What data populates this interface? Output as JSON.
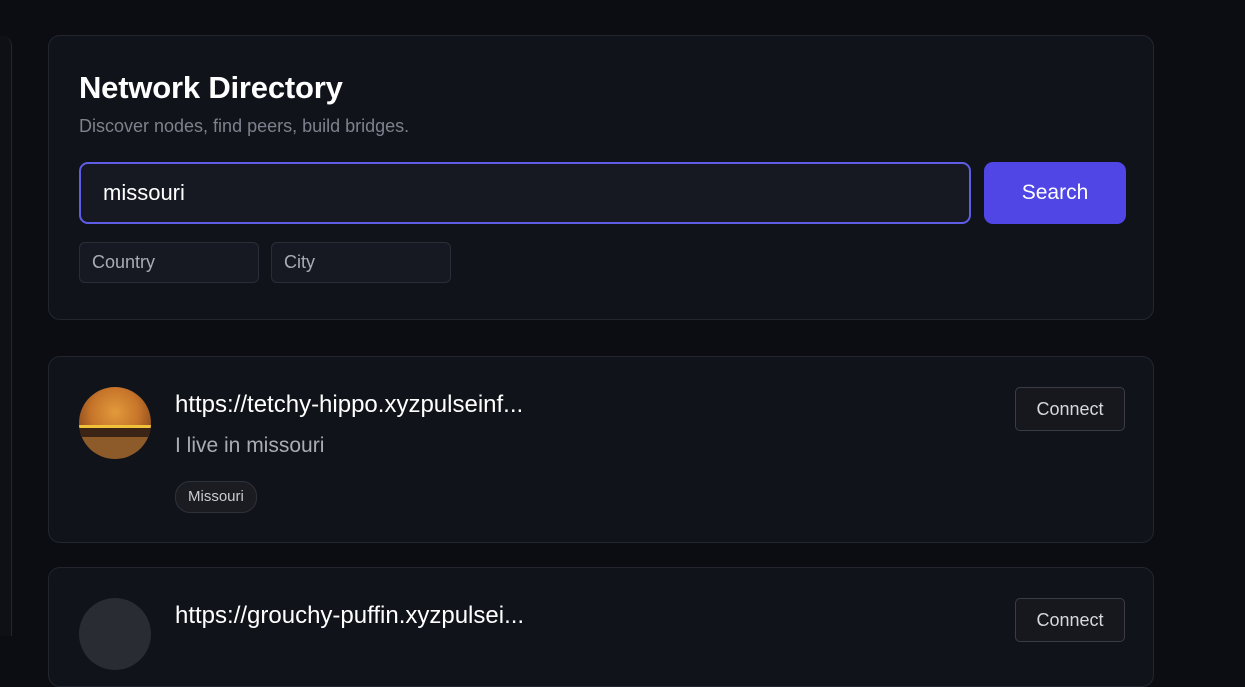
{
  "header": {
    "title": "Network Directory",
    "subtitle": "Discover nodes, find peers, build bridges."
  },
  "search": {
    "value": "missouri",
    "button_label": "Search"
  },
  "filters": {
    "country_placeholder": "Country",
    "city_placeholder": "City"
  },
  "results": [
    {
      "url": "https://tetchy-hippo.xyzpulseinf...",
      "description": "I live in missouri",
      "tag": "Missouri",
      "connect_label": "Connect",
      "avatar_icon": "burger-photo"
    },
    {
      "url": "https://grouchy-puffin.xyzpulsei...",
      "connect_label": "Connect",
      "avatar_icon": "default-avatar"
    }
  ],
  "colors": {
    "accent": "#4f46e5",
    "focus_border": "#5f5ce6",
    "background": "#0b0d13",
    "card": "#11131a"
  }
}
